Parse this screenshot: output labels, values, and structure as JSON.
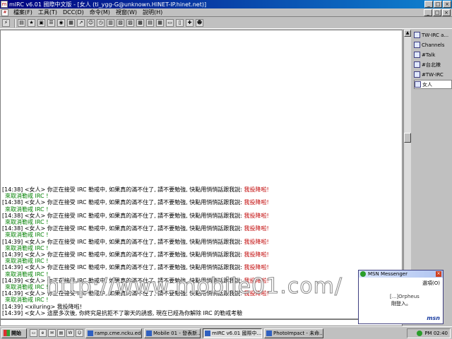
{
  "window": {
    "title": "mIRC v6.01 國際中文版 - [女人 (ti_ygg-G@unknown.HINET-IP.hinet.net)]",
    "minimize": "_",
    "maximize": "□",
    "close": "×"
  },
  "menu": {
    "items": [
      "檔案(F)",
      "工具(T)",
      "DCC(D)",
      "命令(M)",
      "視窗(W)",
      "說明(H)"
    ]
  },
  "chat": {
    "lines": [
      {
        "time": "[14:38]",
        "nick": "<女人>",
        "text": "你正在接受 IRC 勒戒中, 如果真的滿不住了, 請不要勉強, 快點用悄悄話跟我說:",
        "red": "我投降啦!"
      },
      {
        "green": "來取消勒戒 IRC !"
      },
      {
        "time": "[14:38]",
        "nick": "<女人>",
        "text": "你正在接受 IRC 勒戒中, 如果真的滿不住了, 請不要勉強, 快點用悄悄話跟我說:",
        "red": "我投降啦!"
      },
      {
        "green": "來取消勒戒 IRC !"
      },
      {
        "time": "[14:38]",
        "nick": "<女人>",
        "text": "你正在接受 IRC 勒戒中, 如果真的滿不住了, 請不要勉強, 快點用悄悄話跟我說:",
        "red": "我投降啦!"
      },
      {
        "green": "來取消勒戒 IRC !"
      },
      {
        "time": "[14:38]",
        "nick": "<女人>",
        "text": "你正在接受 IRC 勒戒中, 如果真的滿不住了, 請不要勉強, 快點用悄悄話跟我說:",
        "red": "我投降啦!"
      },
      {
        "green": "來取消勒戒 IRC !"
      },
      {
        "time": "[14:39]",
        "nick": "<女人>",
        "text": "你正在接受 IRC 勒戒中, 如果真的滿不住了, 請不要勉強, 快點用悄悄話跟我說:",
        "red": "我投降啦!"
      },
      {
        "green": "來取消勒戒 IRC !"
      },
      {
        "time": "[14:39]",
        "nick": "<女人>",
        "text": "你正在接受 IRC 勒戒中, 如果真的滿不住了, 請不要勉強, 快點用悄悄話跟我說:",
        "red": "我投降啦!"
      },
      {
        "green": "來取消勒戒 IRC !"
      },
      {
        "time": "[14:39]",
        "nick": "<女人>",
        "text": "你正在接受 IRC 勒戒中, 如果真的滿不住了, 請不要勉強, 快點用悄悄話跟我說:",
        "red": "我投降啦!"
      },
      {
        "green": "來取消勒戒 IRC !"
      },
      {
        "time": "[14:39]",
        "nick": "<女人>",
        "text": "你正在接受 IRC 勒戒中, 如果真的滿不住了, 請不要勉強, 快點用悄悄話跟我說:",
        "red": "我投降啦!"
      },
      {
        "green": "來取消勒戒 IRC !"
      },
      {
        "time": "[14:39]",
        "nick": "<女人>",
        "text": "你正在接受 IRC 勒戒中, 如果真的滿不住了, 請不要勉強, 快點用悄悄話跟我說:",
        "red": "我投降啦!"
      },
      {
        "green": "來取消勒戒 IRC !"
      },
      {
        "time": "[14:39]",
        "nick": "<xiluring>",
        "text": "我投降啦!",
        "red": ""
      },
      {
        "time": "[14:39]",
        "nick": "<女人>",
        "text": "這麼多次後, 你終究是抗拒不了聊天的誘惑, 現在已經為你解除 IRC 的勒戒考驗",
        "red": ""
      }
    ]
  },
  "switchbar": {
    "items": [
      "TW-IRC a...",
      "Channels",
      "#Talk",
      "#台北辣",
      "#TW-IRC",
      "女人"
    ],
    "active_index": 5
  },
  "msn": {
    "title": "MSN Messenger",
    "options": "選項(O)",
    "user": "[...]Orpheus",
    "message": "剛登入。",
    "logo": "msn"
  },
  "watermark": "http://www.mobile01.com/",
  "taskbar": {
    "start": "開始",
    "tasks": [
      "ramp.cme.ncku.edu.tw...",
      "Mobile 01 - 發表新...",
      "mIRC v6.01 國際中...",
      "PhotoImpact - 未命..."
    ],
    "active_task": 2,
    "clock": "PM 02:40"
  }
}
